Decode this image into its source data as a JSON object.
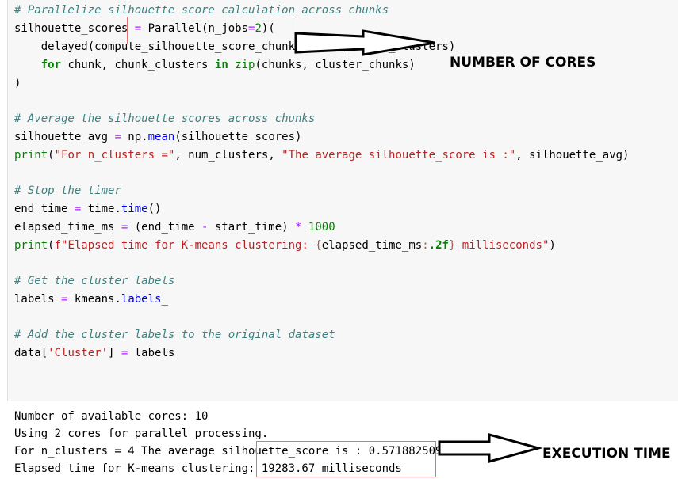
{
  "code": {
    "l1_comment": "# Parallelize silhouette score calculation across chunks",
    "l2_var": "silhouette_scores",
    "l2_eq": "=",
    "l2_call": "Parallel(n_jobs",
    "l2_eq2": "=",
    "l2_num": "2",
    "l2_tail": ")(",
    "l3_indent": "    ",
    "l3_text": "delayed(compute_silhouette_score_chunk)(chunk, chunk_clusters)",
    "l4_indent": "    ",
    "l4_for": "for",
    "l4_mid": " chunk, chunk_clusters ",
    "l4_in": "in",
    "l4_space": " ",
    "l4_zip": "zip",
    "l4_tail": "(chunks, cluster_chunks)",
    "l5_text": ")",
    "l7_comment": "# Average the silhouette scores across chunks",
    "l8_var": "silhouette_avg ",
    "l8_eq": "=",
    "l8_np": " np.",
    "l8_mean": "mean",
    "l8_tail": "(silhouette_scores)",
    "l9_print": "print",
    "l9_p1": "(",
    "l9_s1": "\"For n_clusters =\"",
    "l9_p2": ", num_clusters, ",
    "l9_s2": "\"The average silhouette_score is :\"",
    "l9_p3": ", silhouette_avg)",
    "l11_comment": "# Stop the timer",
    "l12_var": "end_time ",
    "l12_eq": "=",
    "l12_time": " time.",
    "l12_fn": "time",
    "l12_tail": "()",
    "l13_var": "elapsed_time_ms ",
    "l13_eq": "=",
    "l13_p1": " (end_time ",
    "l13_minus": "-",
    "l13_p2": " start_time) ",
    "l13_mul": "*",
    "l13_sp": " ",
    "l13_num": "1000",
    "l14_print": "print",
    "l14_p1": "(",
    "l14_s1": "f\"Elapsed time for K-means clustering: ",
    "l14_b1": "{",
    "l14_var": "elapsed_time_ms",
    "l14_colon": ":",
    "l14_fmt": ".2f",
    "l14_b2": "}",
    "l14_s2": " milliseconds\"",
    "l14_p2": ")",
    "l16_comment": "# Get the cluster labels",
    "l17_var": "labels ",
    "l17_eq": "=",
    "l17_mid": " kmeans.",
    "l17_attr": "labels_",
    "l19_comment": "# Add the cluster labels to the original dataset",
    "l20_data": "data",
    "l20_b1": "[",
    "l20_str": "'Cluster'",
    "l20_b2": "]",
    "l20_sp": " ",
    "l20_eq": "=",
    "l20_tail": " labels"
  },
  "output": {
    "line1": "Number of available cores: 10",
    "line2": "Using 2 cores for parallel processing.",
    "line3": "For n_clusters = 4 The average silhouette_score is : 0.5718825090151425",
    "line4": "Elapsed time for K-means clustering: 19283.67 milliseconds"
  },
  "annotations": {
    "cores_label": "NUMBER OF CORES",
    "time_label": "EXECUTION TIME"
  },
  "colors": {
    "highlight_box": "#e86f6f",
    "comment": "#408080",
    "keyword": "#008000",
    "string": "#ba2121",
    "operator": "#aa22ff"
  }
}
